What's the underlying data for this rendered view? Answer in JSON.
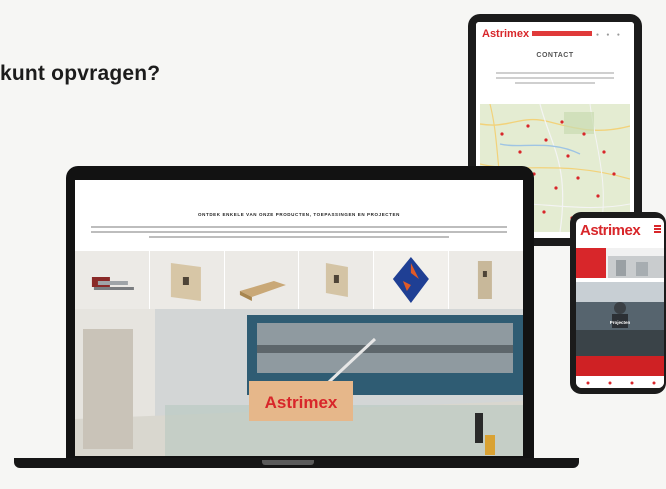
{
  "headline": "kunt opvragen?",
  "brand": {
    "logo": "Astrimex",
    "accent": "#d8262a"
  },
  "tablet": {
    "page_title": "CONTACT"
  },
  "laptop": {
    "heading": "Ontdek enkele van onze producten, toepassingen en projecten",
    "sign_text": "Astrimex"
  },
  "phone": {
    "logo": "Astrimex",
    "hero_title": "Projecten"
  }
}
